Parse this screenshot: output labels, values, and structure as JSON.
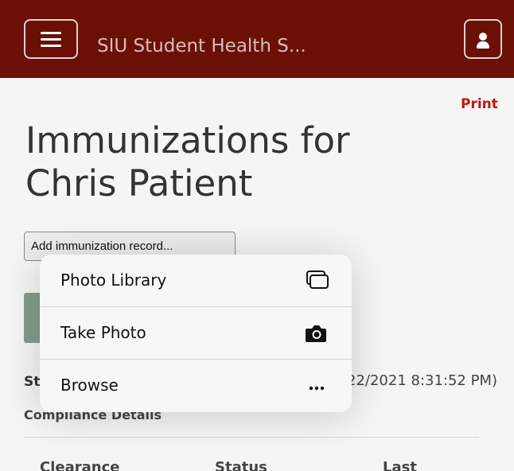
{
  "header": {
    "app_title": "SIU Student Health S..."
  },
  "main": {
    "print_label": "Print",
    "title_line1": "Immunizations for",
    "title_line2": "Chris Patient",
    "add_record_label": "Add immunization record...",
    "status_prefix": "St",
    "status_date": "22/2021 8:31:52 PM)",
    "compliance_heading": "Compliance Details",
    "table_headers": [
      "Clearance",
      "Status",
      "Last"
    ]
  },
  "popover": {
    "items": [
      {
        "label": "Photo Library",
        "icon": "photo-library-icon"
      },
      {
        "label": "Take Photo",
        "icon": "camera-icon"
      },
      {
        "label": "Browse",
        "icon": "ellipsis-icon"
      }
    ]
  },
  "colors": {
    "header_bg": "#6b1007",
    "accent_red": "#c0170b",
    "green_button": "#829e8e"
  }
}
